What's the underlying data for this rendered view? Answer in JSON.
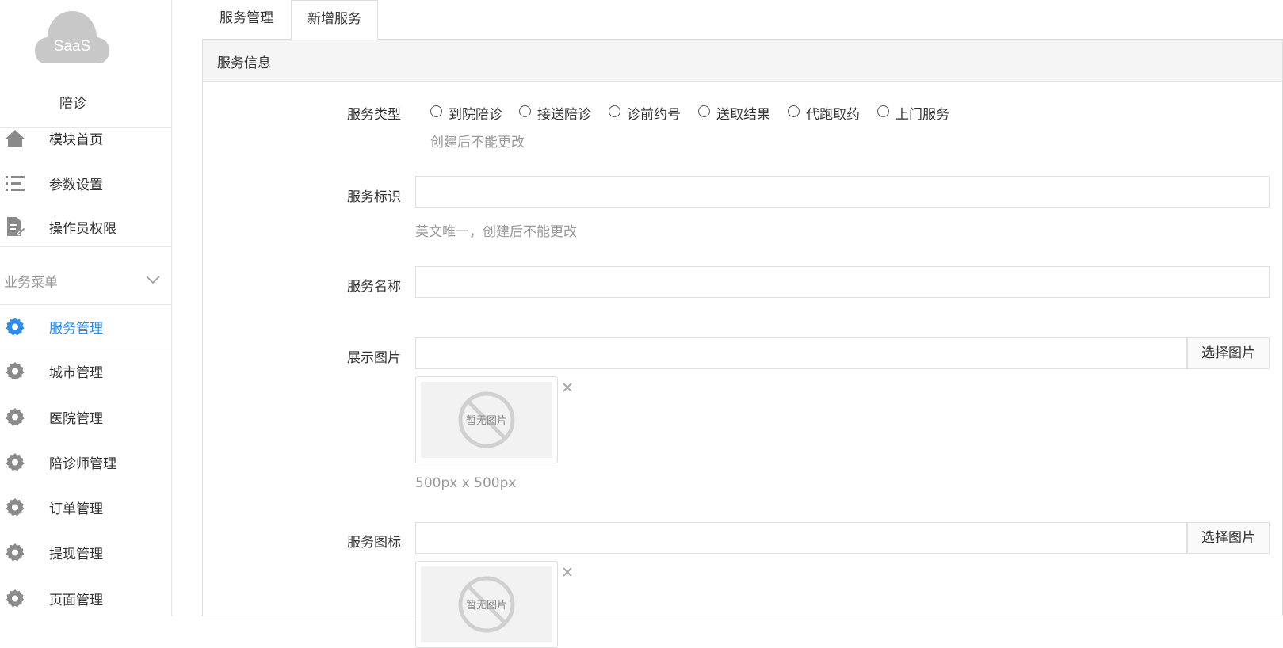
{
  "sidebar": {
    "logo_text": "SaaS",
    "app_name": "陪诊",
    "top_items": [
      {
        "label": "模块首页",
        "icon": "home-icon"
      },
      {
        "label": "参数设置",
        "icon": "list-icon"
      },
      {
        "label": "操作员权限",
        "icon": "document-edit-icon"
      }
    ],
    "group_title": "业务菜单",
    "business_items": [
      {
        "label": "服务管理",
        "icon": "gear-icon",
        "active": true
      },
      {
        "label": "城市管理",
        "icon": "gear-icon"
      },
      {
        "label": "医院管理",
        "icon": "gear-icon"
      },
      {
        "label": "陪诊师管理",
        "icon": "gear-icon"
      },
      {
        "label": "订单管理",
        "icon": "gear-icon"
      },
      {
        "label": "提现管理",
        "icon": "gear-icon"
      },
      {
        "label": "页面管理",
        "icon": "gear-icon"
      }
    ]
  },
  "tabs": [
    "服务管理",
    "新增服务"
  ],
  "panel_title": "服务信息",
  "form": {
    "service_type": {
      "label": "服务类型",
      "options": [
        "到院陪诊",
        "接送陪诊",
        "诊前约号",
        "送取结果",
        "代跑取药",
        "上门服务"
      ],
      "hint": "创建后不能更改"
    },
    "service_id": {
      "label": "服务标识",
      "value": "",
      "hint": "英文唯一，创建后不能更改"
    },
    "service_name": {
      "label": "服务名称",
      "value": ""
    },
    "display_image": {
      "label": "展示图片",
      "value": "",
      "button": "选择图片",
      "placeholder_text": "暂无图片",
      "hint": "500px x 500px"
    },
    "service_icon": {
      "label": "服务图标",
      "value": "",
      "button": "选择图片",
      "placeholder_text": "暂无图片"
    }
  },
  "colors": {
    "accent": "#2d8cf0",
    "icon_gray": "#8a8a8a",
    "hint": "#999999"
  }
}
